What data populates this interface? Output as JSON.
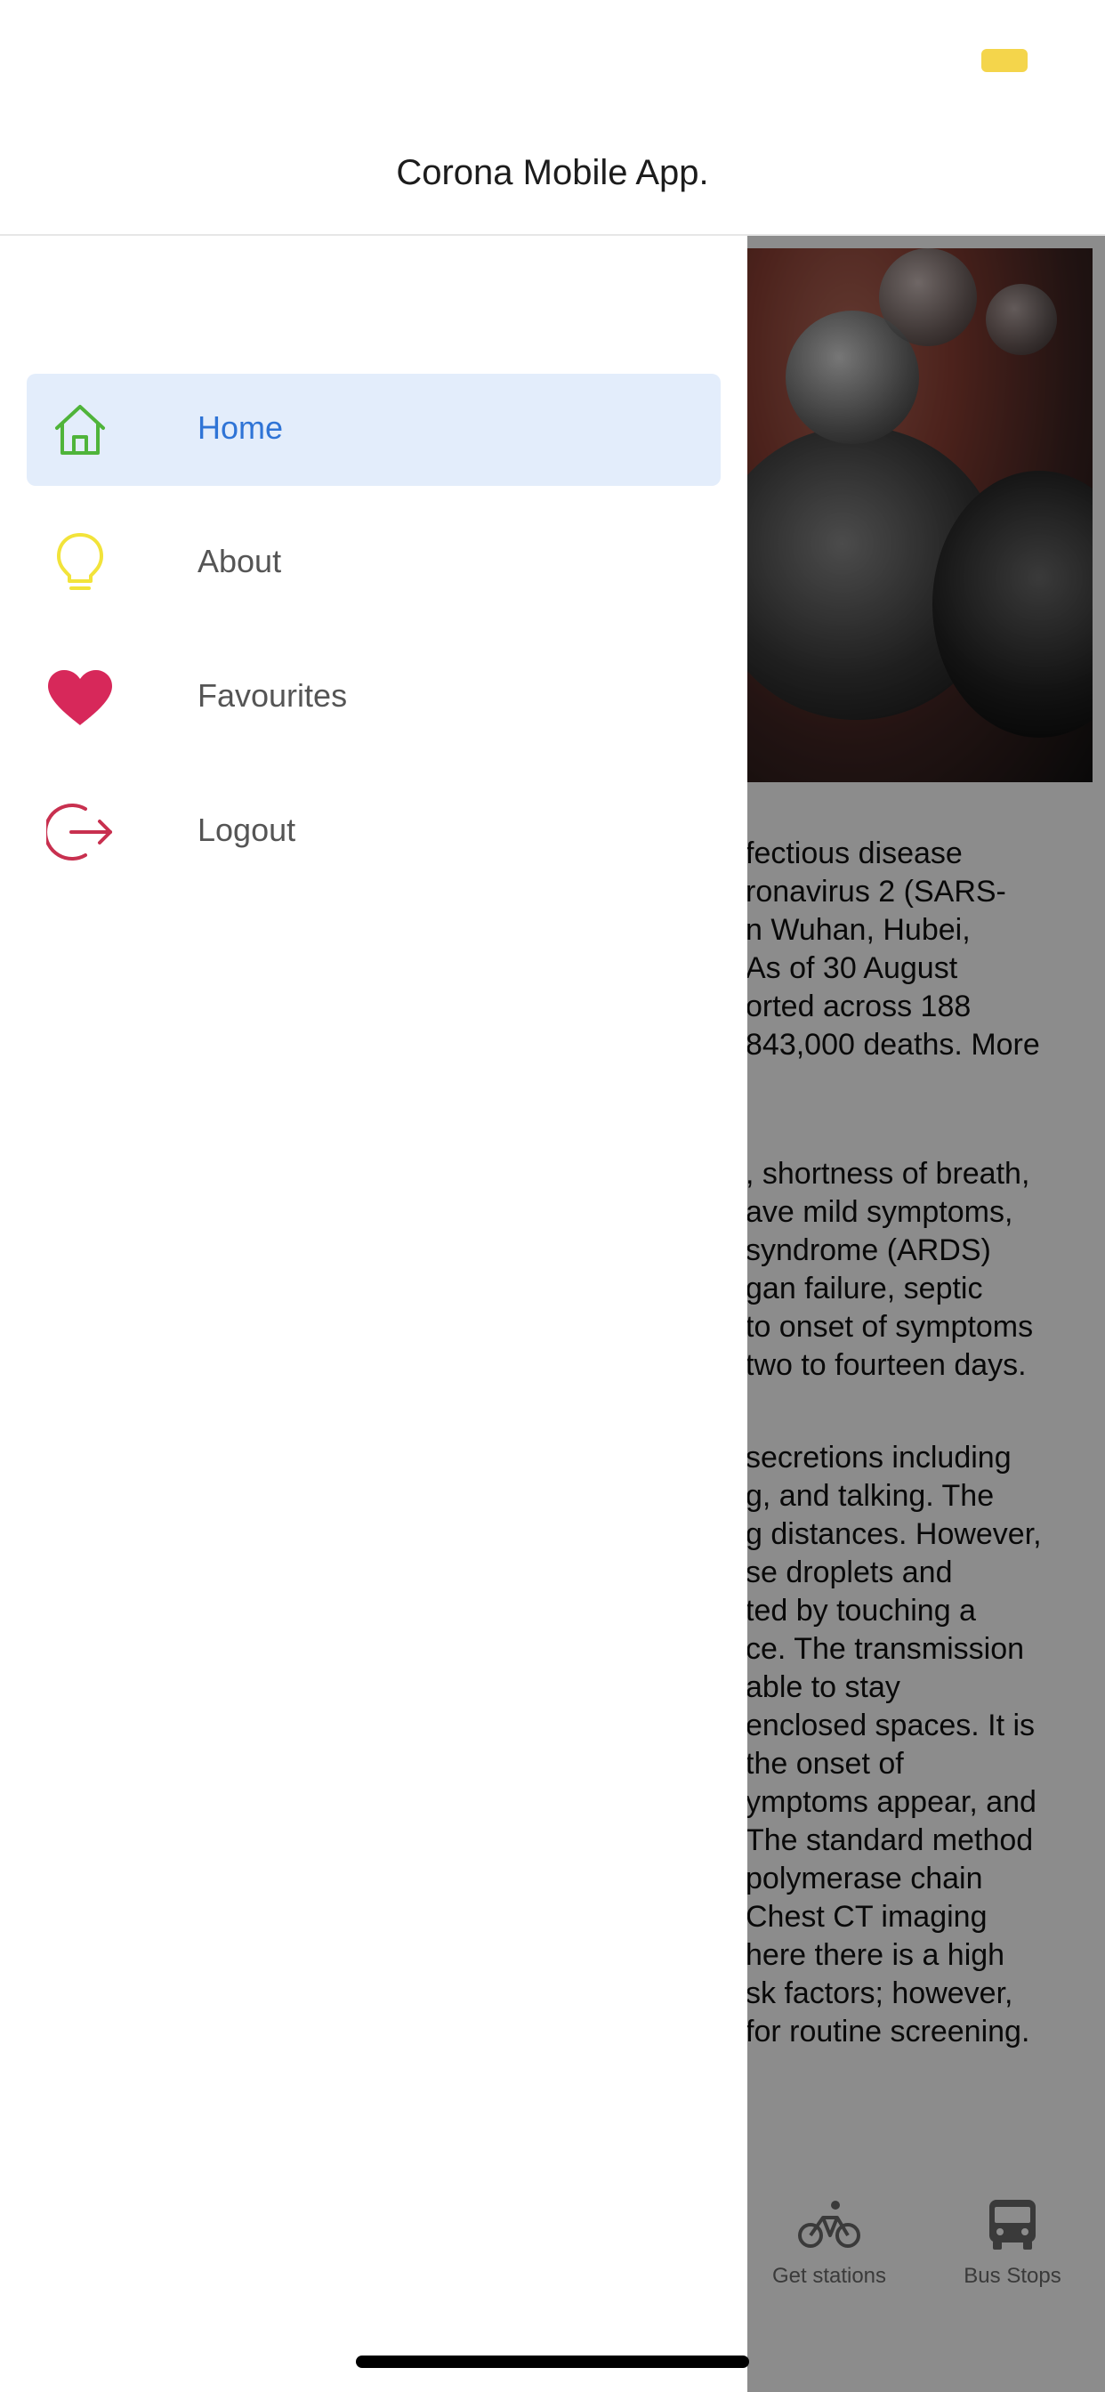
{
  "header": {
    "title": "Corona Mobile App."
  },
  "drawer": {
    "items": [
      {
        "label": "Home",
        "icon": "home-icon",
        "active": true,
        "icon_color": "#4fb43a"
      },
      {
        "label": "About",
        "icon": "lightbulb-icon",
        "active": false,
        "icon_color": "#f2e33a"
      },
      {
        "label": "Favourites",
        "icon": "heart-icon",
        "active": false,
        "icon_color": "#d7285a"
      },
      {
        "label": "Logout",
        "icon": "logout-icon",
        "active": false,
        "icon_color": "#c8304f"
      }
    ],
    "active_color": "#2f74d6",
    "active_bg": "#e3edfb"
  },
  "page": {
    "paragraph1": [
      "fectious disease",
      "ronavirus 2 (SARS-",
      "n Wuhan, Hubei,",
      " As of 30 August",
      "orted across 188",
      "843,000 deaths. More"
    ],
    "paragraph2": [
      ", shortness of breath,",
      "ave mild symptoms,",
      "syndrome (ARDS)",
      "gan failure, septic",
      "to onset of symptoms",
      " two to fourteen days."
    ],
    "paragraph3": [
      "secretions including",
      "g, and talking. The",
      "g distances. However,",
      "se droplets and",
      "ted by touching a",
      "ce. The transmission",
      " able to stay",
      " enclosed spaces. It is",
      " the onset of",
      "ymptoms appear, and",
      " The standard method",
      " polymerase chain",
      " Chest CT imaging",
      "here there is a high",
      "sk factors; however,",
      "for routine screening."
    ],
    "tabs": [
      {
        "label": "Get stations",
        "icon": "bicycle-icon"
      },
      {
        "label": "Bus Stops",
        "icon": "bus-icon"
      }
    ]
  }
}
